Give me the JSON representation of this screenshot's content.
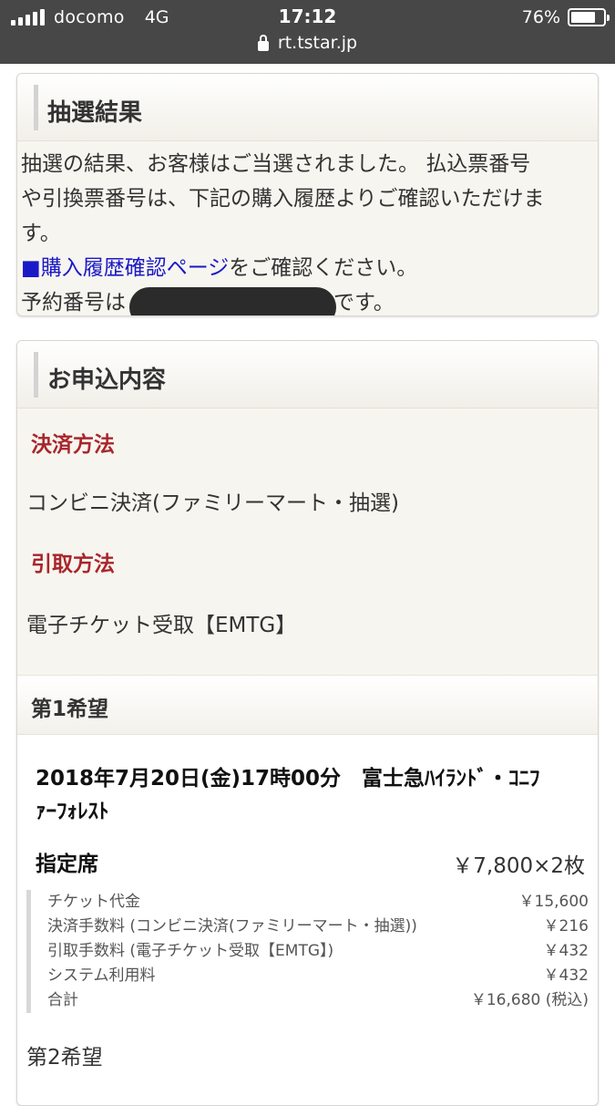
{
  "status_bar": {
    "carrier": "docomo",
    "network": "4G",
    "time": "17:12",
    "battery": "76%",
    "battery_level": 0.76,
    "url": "rt.tstar.jp"
  },
  "lottery_result": {
    "title": "抽選結果",
    "line1": "抽選の結果、お客様はご当選されました。 払込票番号",
    "line2": "や引換票番号は、下記の購入履歴よりご確認いただけま",
    "line3": "す。",
    "link_text": "■購入履歴確認ページ",
    "link_suffix": "をご確認ください。",
    "reservation_prefix": "予約番号は",
    "reservation_suffix": "です。"
  },
  "application": {
    "title": "お申込内容",
    "payment_label": "決済方法",
    "payment_value": "コンビニ決済(ファミリーマート・抽選)",
    "pickup_label": "引取方法",
    "pickup_value": "電子チケット受取【EMTG】",
    "first_choice": {
      "label": "第1希望",
      "event_line1": "2018年7月20日(金)17時00分　富士急ﾊｲﾗﾝﾄﾞ・ｺﾆﾌ",
      "event_line2": "ｧｰﾌｫﾚｽﾄ",
      "seat_type": "指定席",
      "unit_price": "￥7,800×2枚",
      "fees": [
        {
          "label": "チケット代金",
          "amount": "￥15,600"
        },
        {
          "label": "決済手数料 (コンビニ決済(ファミリーマート・抽選))",
          "amount": "￥216"
        },
        {
          "label": "引取手数料 (電子チケット受取【EMTG】)",
          "amount": "￥432"
        },
        {
          "label": "システム利用料",
          "amount": "￥432"
        },
        {
          "label": "合計",
          "amount": "￥16,680 (税込)"
        }
      ]
    },
    "second_choice_label": "第2希望"
  }
}
